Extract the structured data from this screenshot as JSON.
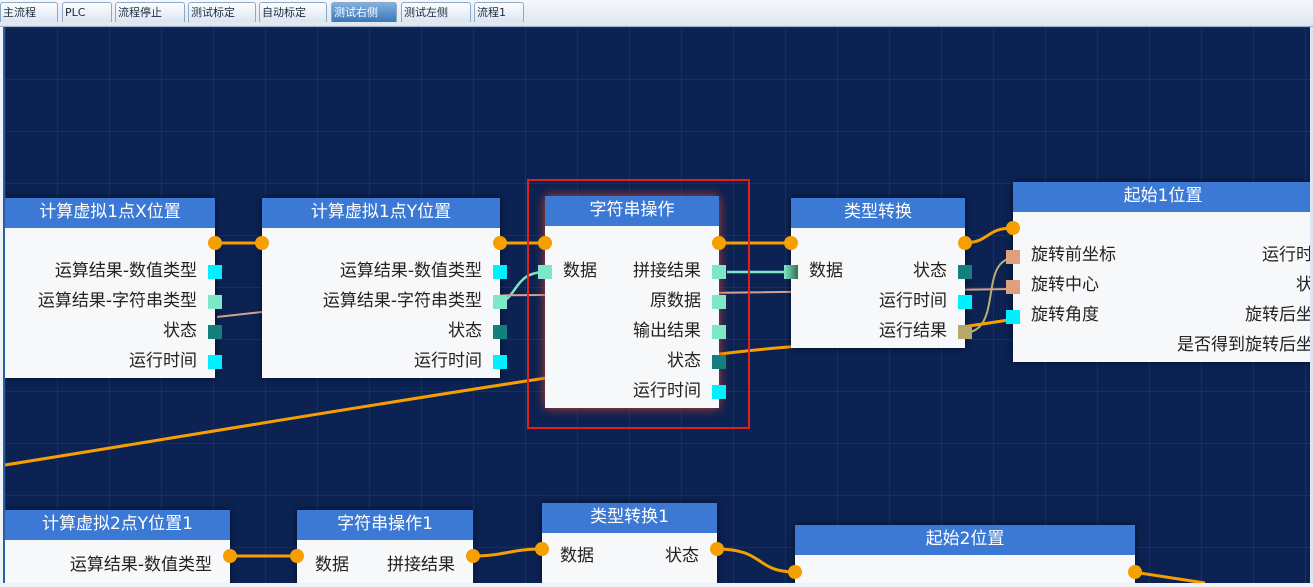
{
  "tabs": [
    {
      "label": "主流程",
      "active": false
    },
    {
      "label": "PLC",
      "active": false
    },
    {
      "label": "流程停止",
      "active": false
    },
    {
      "label": "测试标定",
      "active": false
    },
    {
      "label": "自动标定",
      "active": false
    },
    {
      "label": "测试右侧",
      "active": true
    },
    {
      "label": "测试左侧",
      "active": false
    },
    {
      "label": "流程1",
      "active": false
    }
  ],
  "colors": {
    "canvas": "#0b2252",
    "header": "#3b79d4",
    "wire_main": "#f5a000",
    "highlight": "#e0201c",
    "port_cyan": "#00f0ff",
    "port_mint": "#7de8c8",
    "port_teal": "#14807e",
    "port_olive": "#b8a76a",
    "port_salmon": "#e0a080"
  },
  "nodes": {
    "calc_x": {
      "title": "计算虚拟1点X位置",
      "rows": [
        "运算结果-数值类型",
        "运算结果-字符串类型",
        "状态",
        "运行时间"
      ]
    },
    "calc_y": {
      "title": "计算虚拟1点Y位置",
      "rows": [
        "运算结果-数值类型",
        "运算结果-字符串类型",
        "状态",
        "运行时间"
      ]
    },
    "str_op": {
      "title": "字符串操作",
      "input": "数据",
      "rows": [
        "拼接结果",
        "原数据",
        "输出结果",
        "状态",
        "运行时间"
      ]
    },
    "type_conv": {
      "title": "类型转换",
      "input": "数据",
      "rows": [
        "状态",
        "运行时间",
        "运行结果"
      ]
    },
    "start1": {
      "title": "起始1位置",
      "inputs": [
        "旋转前坐标",
        "旋转中心",
        "旋转角度"
      ],
      "rows": [
        "运行时",
        "状",
        "旋转后坐",
        "是否得到旋转后坐"
      ]
    },
    "calc_2y": {
      "title": "计算虚拟2点Y位置1",
      "rows": [
        "运算结果-数值类型"
      ]
    },
    "str_op1": {
      "title": "字符串操作1",
      "input": "数据",
      "rows": [
        "拼接结果"
      ]
    },
    "type_conv1": {
      "title": "类型转换1",
      "input": "数据",
      "rows": [
        "状态"
      ]
    },
    "start2": {
      "title": "起始2位置"
    }
  }
}
